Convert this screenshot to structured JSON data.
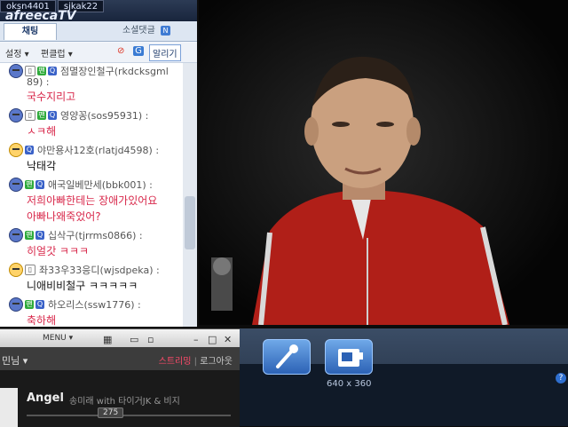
{
  "chat_panel": {
    "logo": "afreecaTV",
    "top_tabs": [
      "oksn4401",
      "sjkak22"
    ],
    "tabs": {
      "active": "채팅",
      "other": "소셜댓글",
      "other_badge": "N"
    },
    "toolbar": {
      "settings": "설정",
      "edit": "편클럽",
      "invite": "알리기"
    },
    "messages": [
      {
        "nick": "점멸장인철구(rkdcksgml",
        "nick_cont": "89) :",
        "text": "국수지리고",
        "text_color": "red",
        "avatar": "blue",
        "badges": [
          "w",
          "g",
          "q"
        ]
      },
      {
        "nick": "영양꽁(sos95931) :",
        "text": "ㅅㅋ해",
        "text_color": "red",
        "avatar": "blue",
        "badges": [
          "w",
          "g",
          "q"
        ]
      },
      {
        "nick": "야만용사12호(rlatjd4598) :",
        "text": "낙태각",
        "text_color": "black",
        "avatar": "yellow",
        "badges": [
          "q"
        ]
      },
      {
        "nick": "애국일베만세(bbk001) :",
        "text": "저희아빠한테는 장애가있어요",
        "text2": "아빠나왜죽었어?",
        "text_color": "red",
        "avatar": "blue",
        "badges": [
          "g",
          "q"
        ]
      },
      {
        "nick": "십삭구(tjrrms0866) :",
        "text": "히얼갓 ㅋㅋㅋ",
        "text_color": "red",
        "avatar": "blue",
        "badges": [
          "g",
          "q"
        ]
      },
      {
        "nick": "좌33우33응디(wjsdpeka) :",
        "text": "니애비비철구 ㅋㅋㅋㅋㅋ",
        "text_color": "black",
        "avatar": "yellow",
        "badges": [
          "w"
        ]
      },
      {
        "nick": "하오리스(ssw1776) :",
        "text": "축하해",
        "text_color": "red",
        "avatar": "blue",
        "badges": [
          "g",
          "q"
        ]
      }
    ]
  },
  "broadcast_bar": {
    "resolution": "640 x 360",
    "help": "?"
  },
  "mini_player": {
    "menu": "MENU",
    "title": "민님",
    "link_streaming": "스트리밍",
    "link_logout": "로그아웃",
    "song": "Angel",
    "sub": "송미래 with 타이거JK & 비지",
    "counter": "275"
  },
  "colors": {
    "chat_red": "#d8274a",
    "accent": "#2c62b5"
  }
}
